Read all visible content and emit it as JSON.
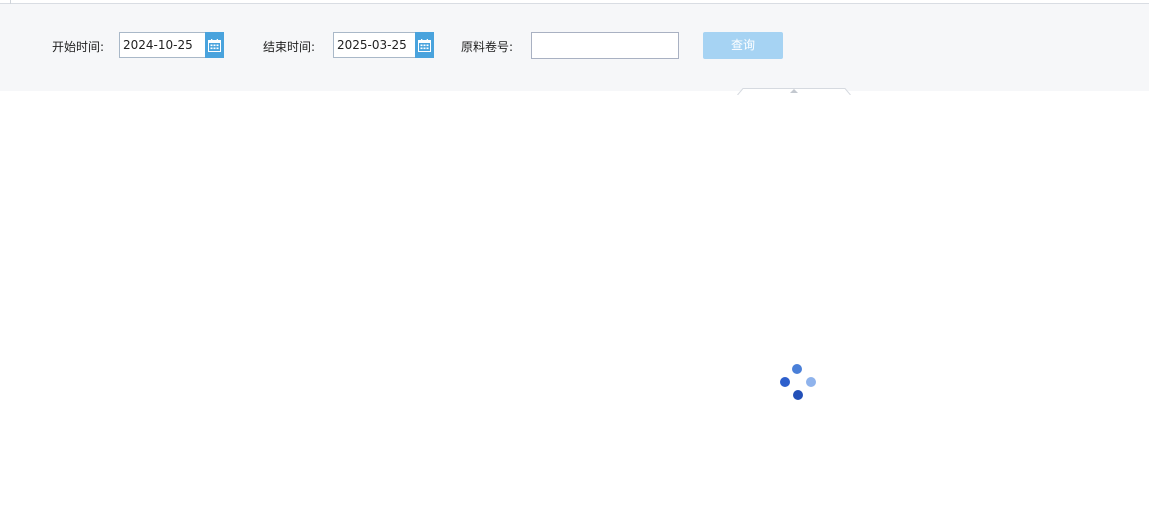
{
  "filters": {
    "start_label": "开始时间:",
    "start_value": "2024-10-25",
    "end_label": "结束时间:",
    "end_value": "2025-03-25",
    "coil_label": "原料卷号:",
    "coil_value": "",
    "query_label": "查询"
  },
  "icons": {
    "calendar": "calendar-icon",
    "loading": "loading-spinner-icon",
    "collapse": "collapse-arrow-icon"
  },
  "colors": {
    "toolbar_bg": "#f6f7f9",
    "calendar_button": "#49a3dd",
    "query_button": "#a6d3f3",
    "spinner_dark": "#2350b8",
    "spinner_mid": "#4a7fd8",
    "spinner_light": "#8fb3ec"
  }
}
